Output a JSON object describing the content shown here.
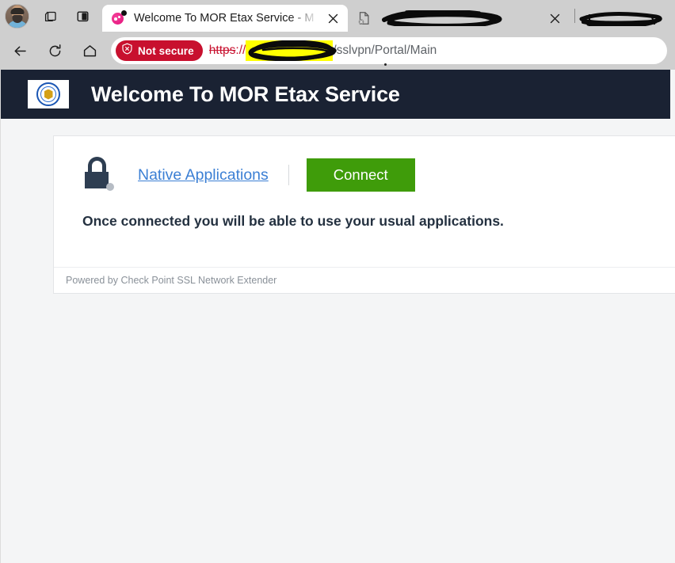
{
  "browser": {
    "profile_avatar": "user-profile-photo",
    "toolbar_icons": [
      "tab-groups-icon",
      "split-screen-icon"
    ],
    "tabs": [
      {
        "title": "Welcome To MOR Etax Service - M",
        "favicon": "pink-circle-favicon",
        "active": true,
        "close_label": "✕"
      },
      {
        "title": "",
        "favicon": "broken-document-icon",
        "active": false,
        "redacted": true,
        "close_label": "✕"
      },
      {
        "title": "",
        "favicon": "",
        "active": false,
        "redacted": true,
        "close_label": ""
      }
    ],
    "nav": {
      "back_icon": "back-arrow-icon",
      "reload_icon": "reload-icon",
      "home_icon": "home-icon"
    },
    "omnibox": {
      "security_badge": "Not secure",
      "security_icon": "shield-warning-icon",
      "url_scheme": "https",
      "url_separator": "://",
      "url_host": "",
      "url_host_redacted": true,
      "url_path": "/sslvpn/Portal/Main"
    }
  },
  "page": {
    "header": {
      "logo_alt": "government-seal-logo",
      "title": "Welcome To MOR Etax Service"
    },
    "card": {
      "lock_icon": "open-padlock-icon",
      "native_link": "Native Applications",
      "connect_button": "Connect",
      "description": "Once connected you will be able to use your usual applications.",
      "footer": "Powered by Check Point SSL Network Extender"
    }
  },
  "colors": {
    "header_bg": "#1a2233",
    "connect_green": "#3f9c0a",
    "link_blue": "#3b7fd4",
    "not_secure_red": "#c8102e",
    "highlight_yellow": "#ffff00",
    "page_bg": "#f4f5f6"
  }
}
